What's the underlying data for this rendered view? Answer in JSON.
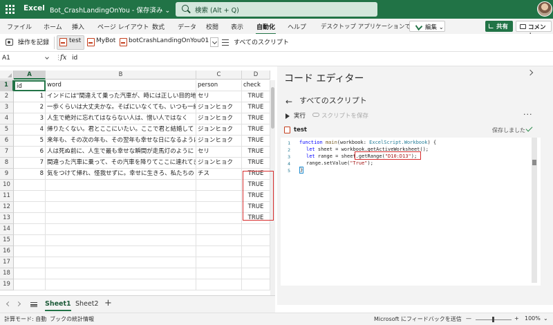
{
  "titlebar": {
    "app_name": "Excel",
    "doc_title": "Bot_CrashLandingOnYou - 保存済み ⌄",
    "search_placeholder": "検索 (Alt + Q)"
  },
  "ribbon": {
    "tabs": [
      "ファイル",
      "ホーム",
      "挿入",
      "ページ レイアウト",
      "数式",
      "データ",
      "校閲",
      "表示",
      "自動化",
      "ヘルプ"
    ],
    "active_tab": "自動化",
    "open_desktop": "デスクトップ アプリケーションで開く",
    "edit_button": "編集 ⌄",
    "share_button": "共有",
    "comment_button": "コメント"
  },
  "toolbar": {
    "record_label": "操作を記録",
    "scripts": [
      "test",
      "MyBot",
      "botCrashLandingOnYou01"
    ],
    "all_scripts": "すべてのスクリプト"
  },
  "formula_bar": {
    "name_box": "A1",
    "dots": "⋮",
    "fx": "fx",
    "value": "id"
  },
  "sheet": {
    "columns": [
      "A",
      "B",
      "C",
      "D"
    ],
    "rows": [
      "1",
      "2",
      "3",
      "4",
      "5",
      "6",
      "7",
      "8",
      "9",
      "10",
      "11",
      "12",
      "13",
      "14",
      "15",
      "16",
      "17",
      "18",
      "19"
    ],
    "header_row": [
      "id",
      "word",
      "person",
      "check"
    ],
    "data_rows": [
      [
        "1",
        "インドには\"間違えて乗った汽車が、時には正しい目的地に連れて行く\"",
        "セリ",
        "TRUE"
      ],
      [
        "2",
        "一歩くらいは大丈夫かな。そばにいなくても、いつも一緒",
        "ジョンヒョク",
        "TRUE"
      ],
      [
        "3",
        "人生で絶対に忘れてはならない人は、憎い人ではなく",
        "ジョンヒョク",
        "TRUE"
      ],
      [
        "4",
        "帰りたくない。君とここにいたい。ここで君と結婚して",
        "ジョンヒョク",
        "TRUE"
      ],
      [
        "5",
        "来年も、その次の年も、その翌年も幸せな日になるように",
        "ジョンヒョク",
        "TRUE"
      ],
      [
        "6",
        "人は死ぬ前に、人生で最も幸せな瞬間が走馬灯のように",
        "セリ",
        "TRUE"
      ],
      [
        "7",
        "間違った汽車に乗って、その汽車を降りてここに連れてきてくれた",
        "ジョンヒョク",
        "TRUE"
      ],
      [
        "8",
        "気をつけて帰れ、怪我せずに。幸せに生きろ、私たちの",
        "チス",
        "TRUE"
      ]
    ],
    "extra_true": [
      "TRUE",
      "TRUE",
      "TRUE",
      "TRUE"
    ]
  },
  "sheet_tabs": {
    "tabs": [
      "Sheet1",
      "Sheet2"
    ],
    "active": "Sheet1",
    "add": "+"
  },
  "editor": {
    "title": "コード エディター",
    "back": "←",
    "breadcrumb": "すべてのスクリプト",
    "run_label": "実行",
    "save_label": "スクリプトを保存",
    "more": "···",
    "script_name": "test",
    "saved_status": "保存しました",
    "line_numbers": [
      "1",
      "2",
      "3",
      "4",
      "5"
    ],
    "code": {
      "l1_kw": "function",
      "l1_fn": "main",
      "l1_a": "(workbook: ",
      "l1_ty": "ExcelScript.Workbook",
      "l1_b": ") {",
      "l2_kw": "let",
      "l2_rest": " sheet = workbook.getActiveWorksheet();",
      "l3_kw": "let",
      "l3_a": " range = sheet.",
      "l3_call": "getRange(",
      "l3_str": "\"D10:D13\"",
      "l3_b": ");",
      "l4_a": "range.setValue(",
      "l4_str": "\"True\"",
      "l4_b": ");",
      "l5": "}"
    }
  },
  "statusbar": {
    "calc_mode": "計算モード: 自動",
    "stats": "ブックの統計情報",
    "feedback": "Microsoft にフィードバックを送信",
    "zoom_minus": "—",
    "zoom_plus": "+",
    "zoom": "100%",
    "zoom_chev": "⌄"
  },
  "colors": {
    "excel_green": "#217346",
    "highlight_red": "#d62b2b"
  }
}
